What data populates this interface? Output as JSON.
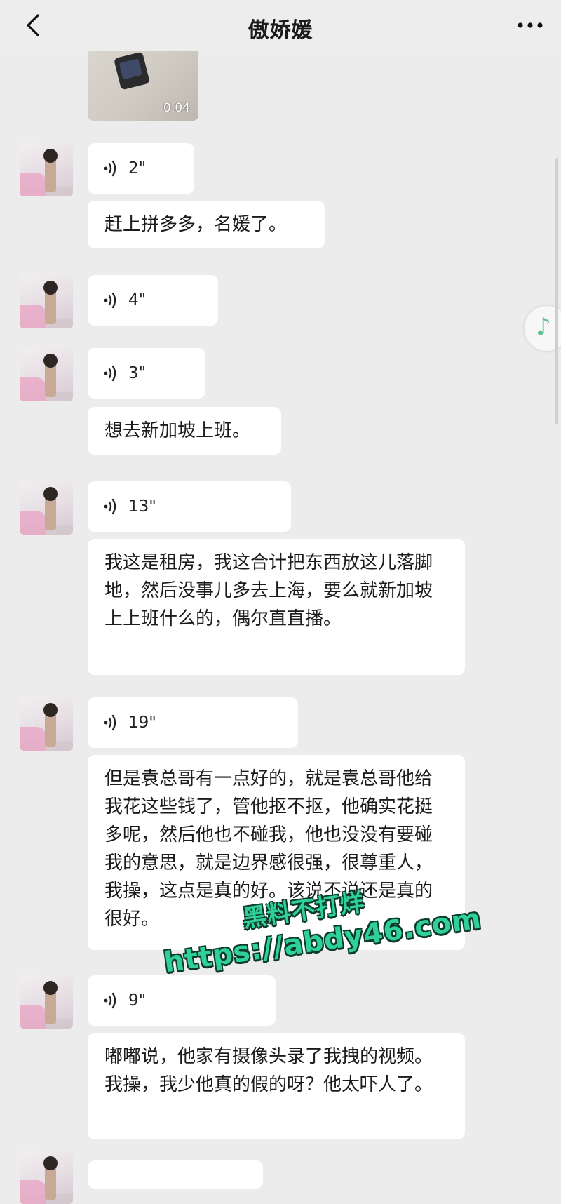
{
  "header": {
    "title": "傲娇媛",
    "back_icon": "chevron-left-icon",
    "more_icon": "more-dots-icon"
  },
  "video": {
    "duration": "0:04"
  },
  "messages": [
    {
      "type": "voice",
      "duration": "2\""
    },
    {
      "type": "text",
      "text": "赶上拼多多，名媛了。"
    },
    {
      "type": "voice",
      "duration": "4\""
    },
    {
      "type": "voice",
      "duration": "3\""
    },
    {
      "type": "text",
      "text": "想去新加坡上班。"
    },
    {
      "type": "voice",
      "duration": "13\""
    },
    {
      "type": "text",
      "text": "我这是租房，我这合计把东西放这儿落脚地，然后没事儿多去上海，要么就新加坡上上班什么的，偶尔直直播。"
    },
    {
      "type": "voice",
      "duration": "19\""
    },
    {
      "type": "text",
      "text": "但是袁总哥有一点好的，就是袁总哥他给我花这些钱了，管他抠不抠，他确实花挺多呢，然后他也不碰我，他也没没有要碰我的意思，就是边界感很强，很尊重人，我操，这点是真的好。该说不说还是真的很好。"
    },
    {
      "type": "voice",
      "duration": "9\""
    },
    {
      "type": "text",
      "text": "嘟嘟说，他家有摄像头录了我拽的视频。我操，我少他真的假的呀？他太吓人了。"
    }
  ],
  "side_button": {
    "icon": "music-note-icon",
    "glyph": "♪"
  },
  "watermark": {
    "line1": "黑料不打烊",
    "line2": "https://abdy46.com"
  },
  "colors": {
    "background": "#ececec",
    "bubble": "#ffffff",
    "watermark": "#2fd19a"
  }
}
